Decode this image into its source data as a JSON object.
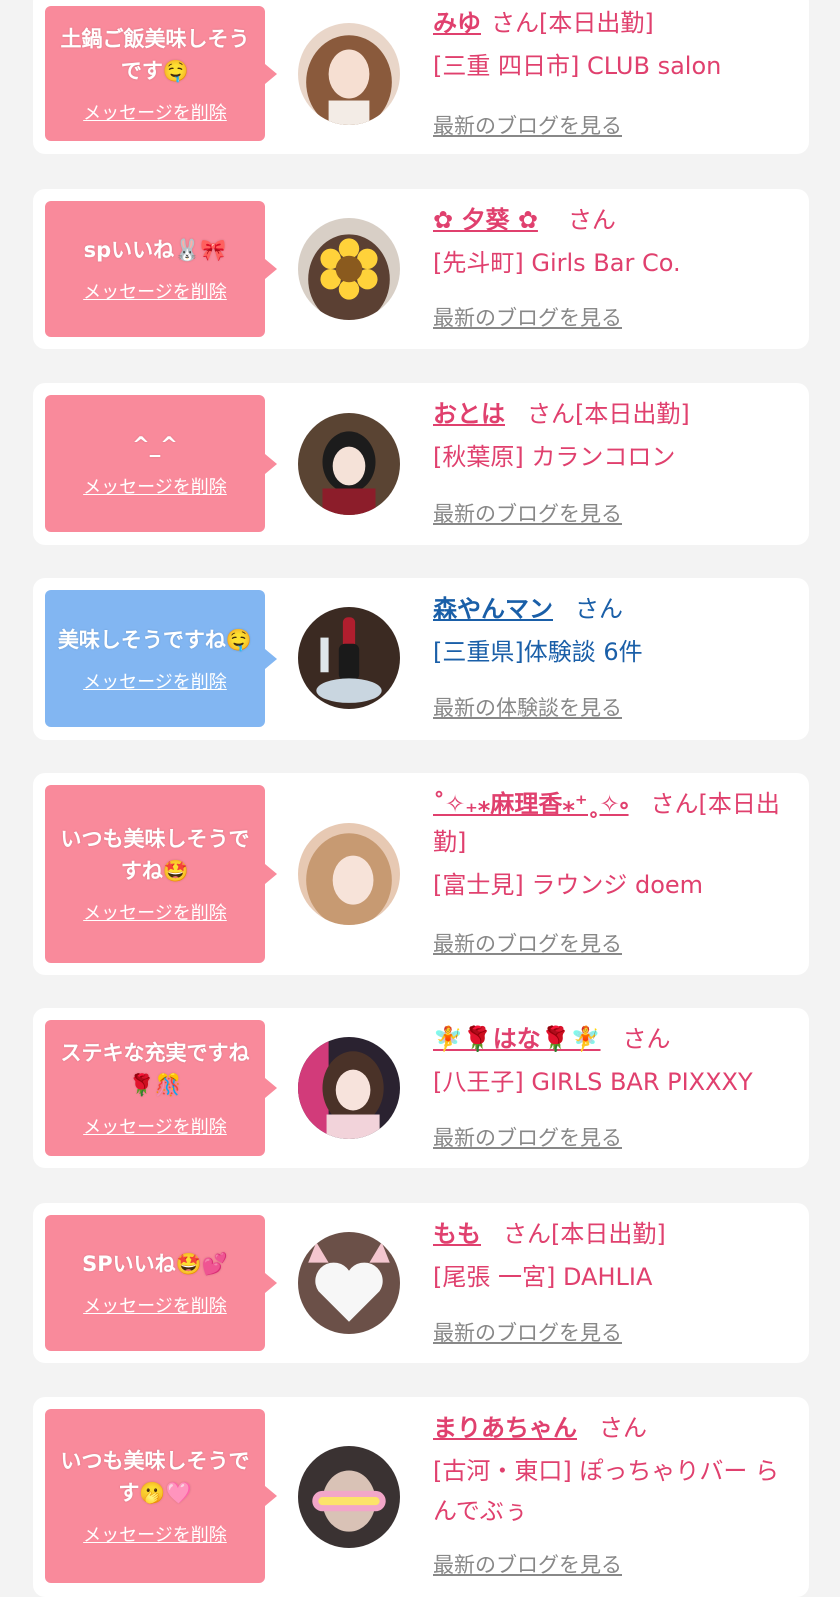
{
  "accent_colors": {
    "pink": "#f98a9b",
    "blue": "#82b6f2",
    "name_pink": "#e0406e",
    "name_blue": "#1a5fa8"
  },
  "items": [
    {
      "message": "土鍋ご飯美味しそうです🤤",
      "delete_label": "メッセージを削除",
      "name": "みゆ",
      "suffix": "さん[本日出勤]",
      "shop": "[三重 四日市] CLUB salon",
      "link": "最新のブログを見る",
      "avatar_icon": "girl-photo"
    },
    {
      "message": "spいいね🐰🎀",
      "delete_label": "メッセージを削除",
      "name": "✿ 夕葵 ✿",
      "suffix": "さん",
      "shop": "[先斗町] Girls Bar Co.",
      "link": "最新のブログを見る",
      "avatar_icon": "sunflower-sticker-photo"
    },
    {
      "message": "^_^",
      "delete_label": "メッセージを削除",
      "name": "おとは",
      "suffix": "さん[本日出勤]",
      "shop": "[秋葉原] カランコロン",
      "link": "最新のブログを見る",
      "avatar_icon": "girl-photo"
    },
    {
      "message": "美味しそうですね🤤",
      "delete_label": "メッセージを削除",
      "name": "森やんマン",
      "suffix": "さん",
      "shop": "[三重県]体験談 6件",
      "link": "最新の体験談を見る",
      "avatar_icon": "champagne-photo"
    },
    {
      "message": "いつも美味しそうですね🤩",
      "delete_label": "メッセージを削除",
      "name": "˚✧₊⁎麻理香⁎⁺˳✧༚",
      "suffix": "さん[本日出勤]",
      "shop": "[富士見] ラウンジ doem",
      "link": "最新のブログを見る",
      "avatar_icon": "girl-photo"
    },
    {
      "message": "ステキな充実ですね🌹🎊",
      "delete_label": "メッセージを削除",
      "name": "🧚🌹はな🌹🧚",
      "suffix": "さん",
      "shop": "[八王子] GIRLS BAR PIXXXY",
      "link": "最新のブログを見る",
      "avatar_icon": "girl-photo"
    },
    {
      "message": "SPいいね🤩💕",
      "delete_label": "メッセージを削除",
      "name": "もも",
      "suffix": "さん[本日出勤]",
      "shop": "[尾張 一宮] DAHLIA",
      "link": "最新のブログを見る",
      "avatar_icon": "heart-sticker-photo"
    },
    {
      "message": "いつも美味しそうです🫢🩷",
      "delete_label": "メッセージを削除",
      "name": "まりあちゃん",
      "suffix": "さん",
      "shop": "[古河・東口] ぽっちゃりバー らんでぶぅ",
      "link": "最新のブログを見る",
      "avatar_icon": "happy-sticker-photo"
    }
  ]
}
